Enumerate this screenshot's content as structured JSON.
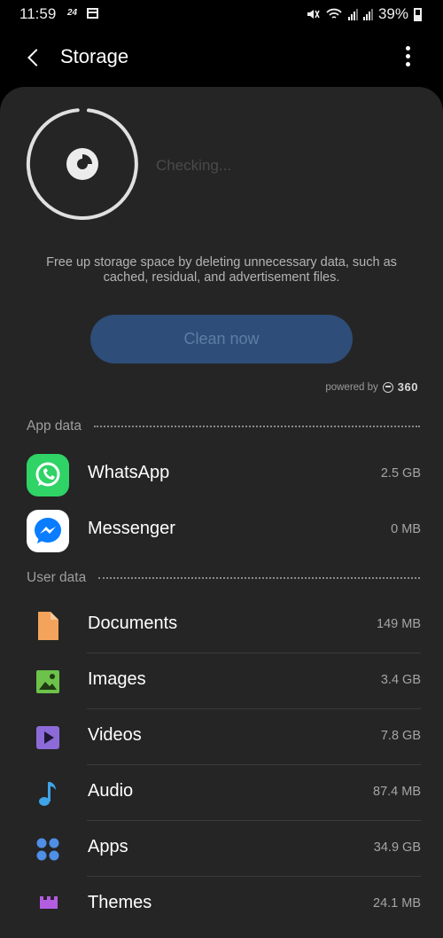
{
  "status_bar": {
    "time": "11:59",
    "badge": "24",
    "battery": "39%"
  },
  "header": {
    "title": "Storage"
  },
  "scan": {
    "status": "Checking...",
    "description": "Free up storage space by deleting unnecessary data, such as cached, residual, and advertisement files.",
    "clean_label": "Clean now",
    "powered_by": "powered by",
    "brand": "360"
  },
  "app_data": {
    "title": "App data",
    "items": [
      {
        "label": "WhatsApp",
        "value": "2.5 GB",
        "icon": "whatsapp-icon",
        "color": "#2fd366"
      },
      {
        "label": "Messenger",
        "value": "0 MB",
        "icon": "messenger-icon",
        "color": "#0a7cff"
      }
    ]
  },
  "user_data": {
    "title": "User data",
    "items": [
      {
        "label": "Documents",
        "value": "149 MB",
        "icon": "document-icon",
        "color": "#f3a35b"
      },
      {
        "label": "Images",
        "value": "3.4 GB",
        "icon": "image-icon",
        "color": "#6cc24a"
      },
      {
        "label": "Videos",
        "value": "7.8 GB",
        "icon": "video-icon",
        "color": "#8c6bd8"
      },
      {
        "label": "Audio",
        "value": "87.4 MB",
        "icon": "audio-icon",
        "color": "#3fa3e8"
      },
      {
        "label": "Apps",
        "value": "34.9 GB",
        "icon": "apps-icon",
        "color": "#4f8fe6"
      },
      {
        "label": "Themes",
        "value": "24.1 MB",
        "icon": "themes-icon",
        "color": "#b35de0"
      }
    ]
  },
  "colors": {
    "background": "#000000",
    "card": "#252525",
    "button": "#2e4d78"
  }
}
